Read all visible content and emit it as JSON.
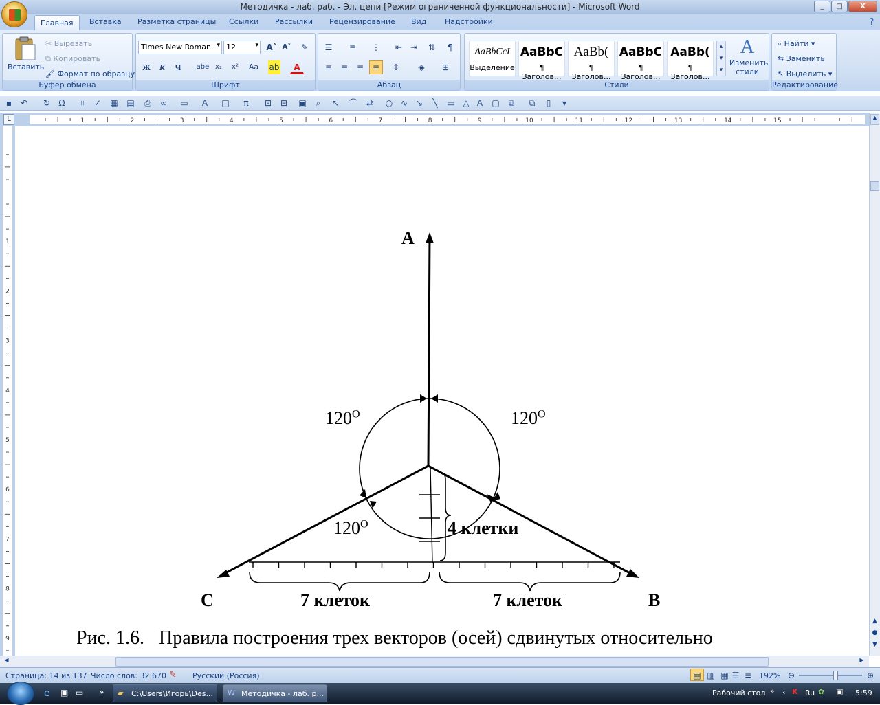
{
  "window": {
    "title": "Методичка - лаб. раб. - Эл. цепи [Режим ограниченной функциональности] - Microsoft Word",
    "controls": {
      "minimize": "_",
      "maximize": "□",
      "close": "X"
    }
  },
  "ribbon_tabs": [
    "Главная",
    "Вставка",
    "Разметка страницы",
    "Ссылки",
    "Рассылки",
    "Рецензирование",
    "Вид",
    "Надстройки"
  ],
  "clipboard": {
    "paste_label": "Вставить",
    "cut_label": "Вырезать",
    "copy_label": "Копировать",
    "format_painter_label": "Формат по образцу",
    "group_label": "Буфер обмена"
  },
  "font": {
    "font_name": "Times New Roman",
    "font_size": "12",
    "bold": "Ж",
    "italic": "К",
    "underline": "Ч",
    "strike": "abe",
    "subscript": "x₂",
    "superscript": "x²",
    "case": "Aa",
    "group_label": "Шрифт"
  },
  "paragraph": {
    "group_label": "Абзац"
  },
  "styles": {
    "items": [
      {
        "preview": "AaBbCcI",
        "caption": "Выделение"
      },
      {
        "preview": "AaBbC",
        "caption": "¶ Заголов..."
      },
      {
        "preview": "AaBb(",
        "caption": "¶ Заголов..."
      },
      {
        "preview": "AaBbC",
        "caption": "¶ Заголов..."
      },
      {
        "preview": "AaBb(",
        "caption": "¶ Заголов..."
      }
    ],
    "change_styles_label": "Изменить стили",
    "group_label": "Стили"
  },
  "editing": {
    "find_label": "Найти",
    "replace_label": "Заменить",
    "select_label": "Выделить",
    "group_label": "Редактирование"
  },
  "ruler": {
    "h_numbers": [
      "1",
      "2",
      "3",
      "4",
      "5",
      "6",
      "7",
      "8",
      "9",
      "10",
      "11",
      "12",
      "13",
      "14",
      "15"
    ],
    "v_numbers": [
      "1",
      "2",
      "3",
      "4",
      "5",
      "6",
      "7",
      "8",
      "9"
    ],
    "tab_selector": "L"
  },
  "document": {
    "labels": {
      "A": "A",
      "B": "B",
      "C": "C"
    },
    "angles": [
      "120",
      "120",
      "120"
    ],
    "degree_mark": "O",
    "vertical_brace": "4 клетки",
    "left_brace": "7 клеток",
    "right_brace": "7 клеток",
    "caption": "Рис. 1.6.   Правила построения трех векторов (осей) сдвинутых относительно"
  },
  "status": {
    "page": "Страница: 14 из 137",
    "words": "Число слов: 32 670",
    "language": "Русский (Россия)",
    "zoom": "192%"
  },
  "taskbar": {
    "items": [
      {
        "label": "C:\\Users\\Игорь\\Des..."
      },
      {
        "label": "Методичка - лаб. р..."
      }
    ],
    "desktop_label": "Рабочий стол",
    "lang": "Ru",
    "time": "5:59"
  },
  "colors": {
    "ribbon_blue": "#15428b",
    "accent_orange": "#d98d17"
  }
}
